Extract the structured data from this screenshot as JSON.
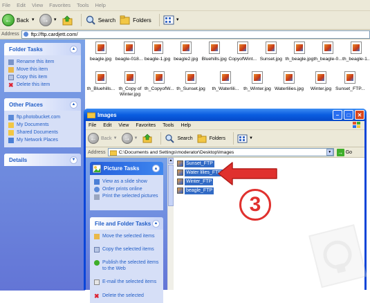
{
  "outer": {
    "menu": [
      "File",
      "Edit",
      "View",
      "Favorites",
      "Tools",
      "Help"
    ],
    "toolbar": {
      "back": "Back",
      "search": "Search",
      "folders": "Folders"
    },
    "address": {
      "label": "Address",
      "value": "ftp://ftp.cardjett.com/"
    },
    "folder_tasks": {
      "title": "Folder Tasks",
      "items": [
        "Rename this item",
        "Move this item",
        "Copy this item",
        "Delete this item"
      ]
    },
    "other_places": {
      "title": "Other Places",
      "items": [
        "ftp.photobucket.com",
        "My Documents",
        "Shared Documents",
        "My Network Places"
      ]
    },
    "details": {
      "title": "Details"
    },
    "files_row1": [
      "beagle.jpg",
      "beagle-018...",
      "beagle-1.jpg",
      "beagle2.jpg",
      "Bluehills.jpg",
      "CopyofWint...",
      "Sunset.jpg",
      "th_beagle.jpg",
      "th_beagle-0...",
      "th_beagle-1..."
    ],
    "files_row2": [
      "th_Bluehills...",
      "th_Copy of Winter.jpg",
      "th_CopyofW...",
      "th_Sunset.jpg",
      "th_Waterlili...",
      "th_Winter.jpg",
      "Waterlilies.jpg",
      "Winter.jpg",
      "Sunset_FTP..."
    ]
  },
  "inner": {
    "title": "Images",
    "menu": [
      "File",
      "Edit",
      "View",
      "Favorites",
      "Tools",
      "Help"
    ],
    "toolbar": {
      "back": "Back",
      "search": "Search",
      "folders": "Folders"
    },
    "address": {
      "label": "Address",
      "value": "C:\\Documents and Settings\\moderator\\Desktop\\Images",
      "go": "Go"
    },
    "picture_tasks": {
      "title": "Picture Tasks",
      "items": [
        "View as a slide show",
        "Order prints online",
        "Print the selected pictures"
      ]
    },
    "file_folder_tasks": {
      "title": "File and Folder Tasks",
      "items": [
        "Move the selected items",
        "Copy the selected items",
        "Publish the selected items to the Web",
        "E-mail the selected items",
        "Delete the selected"
      ]
    },
    "selected_files": [
      "Sunset_FTP",
      "Water lilies_FTP",
      "Winter_FTP",
      "beagle_FTP"
    ]
  },
  "annotation": {
    "step": "3",
    "arrow_color": "#e0312e"
  }
}
